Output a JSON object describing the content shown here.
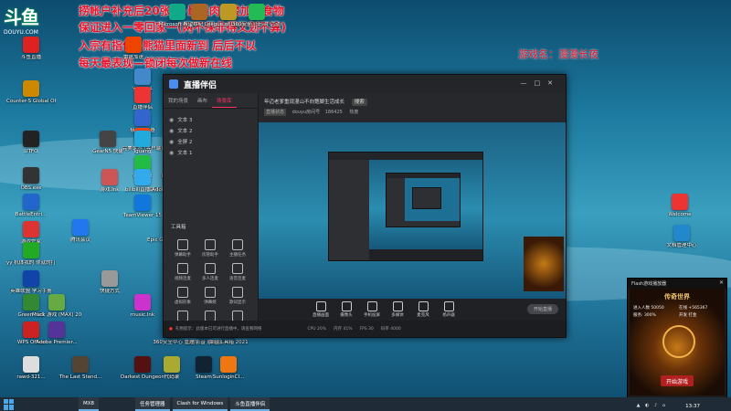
{
  "overlay_lines": [
    "捞帐户补充后20张T+最最肉+梭加工食物",
    "保证进入一零回家一(两不保非得又划不算)",
    "入宗有指使+熊猫里面新到 后后不以",
    "每天最表现—锁闭每次做新在线"
  ],
  "game_name": "游戏名：漫漫长夜",
  "logo": {
    "main": "斗鱼",
    "sub": "DOUYU.COM"
  },
  "desktop_icons": [
    {
      "label": "斗鱼直播",
      "color": "#d22"
    },
    {
      "label": "Counter-S Global Of...",
      "color": "#c80"
    },
    {
      "label": "UTFO",
      "color": "#222"
    },
    {
      "label": "OBS.exe",
      "color": "#333"
    },
    {
      "label": "BattleEntri...",
      "color": "#26c"
    },
    {
      "label": "游戏管家",
      "color": "#d33"
    },
    {
      "label": "yy 机体我的 你就的打",
      "color": "#2a2"
    },
    {
      "label": "英雄联盟 学习手册",
      "color": "#14a"
    },
    {
      "label": "Green Hell",
      "color": "#383"
    },
    {
      "label": "WPS Office",
      "color": "#c22"
    },
    {
      "label": "rawd-321...",
      "color": "#ddd"
    },
    {
      "label": "Microsoft Edge",
      "color": "#1a8"
    },
    {
      "label": "希望世纪 (UP)",
      "color": "#a62"
    },
    {
      "label": "League of Legends",
      "color": "#b92"
    },
    {
      "label": "360安全卫士 对 活动测试",
      "color": "#2b5"
    },
    {
      "label": "雷霆加速",
      "color": "#e40"
    },
    {
      "label": "安装程序",
      "color": "#48c"
    },
    {
      "label": "直播伴侣",
      "color": "#e33"
    },
    {
      "label": "极速浏览器",
      "color": "#36c"
    },
    {
      "label": "完美世界 (客户端)",
      "color": "#e42"
    },
    {
      "label": "WeChat",
      "color": "#2b4"
    },
    {
      "label": "LoL Client",
      "color": "#a82"
    },
    {
      "label": "GearN5 快捷",
      "color": "#444"
    },
    {
      "label": "iguang",
      "color": "#2ad"
    },
    {
      "label": "游戏.lnk",
      "color": "#c55"
    },
    {
      "label": "bilibili直播助手",
      "color": "#3ae"
    },
    {
      "label": "Adobe Premie...",
      "color": "#529"
    },
    {
      "label": "TeamViewer 15",
      "color": "#17d"
    },
    {
      "label": "Epic Games Launcher",
      "color": "#333"
    },
    {
      "label": "腾讯会议",
      "color": "#27e"
    },
    {
      "label": "Muck 游戏 (MAX) 202...",
      "color": "#6a4"
    },
    {
      "label": "Adobe Premier...",
      "color": "#539"
    },
    {
      "label": "The Last Stand...",
      "color": "#543"
    },
    {
      "label": "Darkest Dungeon",
      "color": "#511"
    },
    {
      "label": "代码录",
      "color": "#aa3"
    },
    {
      "label": "Steam",
      "color": "#123"
    },
    {
      "label": "SunloginCl...",
      "color": "#e71"
    },
    {
      "label": "music.lnk",
      "color": "#c3c"
    },
    {
      "label": "迅雷影音 启动器",
      "color": "#27c"
    },
    {
      "label": "弹窗工具箱 2021",
      "color": "#d50"
    },
    {
      "label": "360安全中心 管理",
      "color": "#2a4"
    },
    {
      "label": "快捷方式",
      "color": "#999"
    },
    {
      "label": "Welcome",
      "color": "#e33"
    },
    {
      "label": "文档管理中心",
      "color": "#28c"
    }
  ],
  "app": {
    "title": "直播伴侣",
    "side_tabs": [
      "我的场景",
      "画布",
      "场景库"
    ],
    "scenes": [
      "文本 3",
      "文本 2",
      "全屏 2",
      "文本 1"
    ],
    "tools_heading": "工具箱",
    "tools": [
      "弹幕助手",
      "房管助手",
      "主播任务",
      "视频连麦",
      "多人连麦",
      "语音连麦",
      "虚拟形象",
      "弹幕姬",
      "歌词显示",
      "礼物特效",
      "设置",
      "更多"
    ],
    "room_title": "年迈老爹重现漫山不向蹩脚生活成长",
    "room_tag": "搜索",
    "room_sub": [
      "直播状态",
      "douyu房间号",
      "186425",
      "热度"
    ],
    "bottom_buttons": [
      "直播画面",
      "摄像头",
      "手机投屏",
      "多媒体",
      "麦克风",
      "扬声器"
    ],
    "start_button": "开始直播",
    "status_text": "礼物提示：此版本已可进行直播中，请查看网络",
    "status_stats": [
      "CPU 20%",
      "内存 41%",
      "FPS 30",
      "码率 4000"
    ]
  },
  "flash_window": {
    "title": "Flash游戏播放器",
    "game_title": "传奇世界",
    "lines": [
      "进入人数 50050",
      "在线 +565367",
      "服务: 300%",
      "开发 打金"
    ],
    "play_button": "开始游戏"
  },
  "taskbar": {
    "items": [
      "MX8",
      "任务管理器",
      "Clash for Windows",
      "斗鱼直播伴侣"
    ],
    "clock": "13:37"
  }
}
